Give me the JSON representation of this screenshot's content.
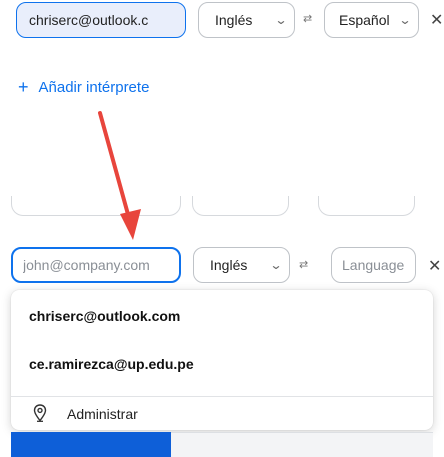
{
  "row1": {
    "email": "chriserc@outlook.c",
    "source_lang": "Inglés",
    "target_lang": "Español",
    "swap_icon": "⇄",
    "close_icon": "✕"
  },
  "add_interpreter": {
    "plus": "+",
    "label": "Añadir intérprete"
  },
  "row2": {
    "email_placeholder": "john@company.com",
    "source_lang": "Inglés",
    "target_placeholder": "Language",
    "swap_icon": "⇄",
    "close_icon": "✕"
  },
  "dropdown": {
    "items": [
      "chriserc@outlook.com",
      "ce.ramirezca@up.edu.pe"
    ],
    "manage_label": "Administrar",
    "manage_icon": "location-pin-icon"
  },
  "colors": {
    "accent": "#0e72ed",
    "arrow": "#e8453c"
  }
}
